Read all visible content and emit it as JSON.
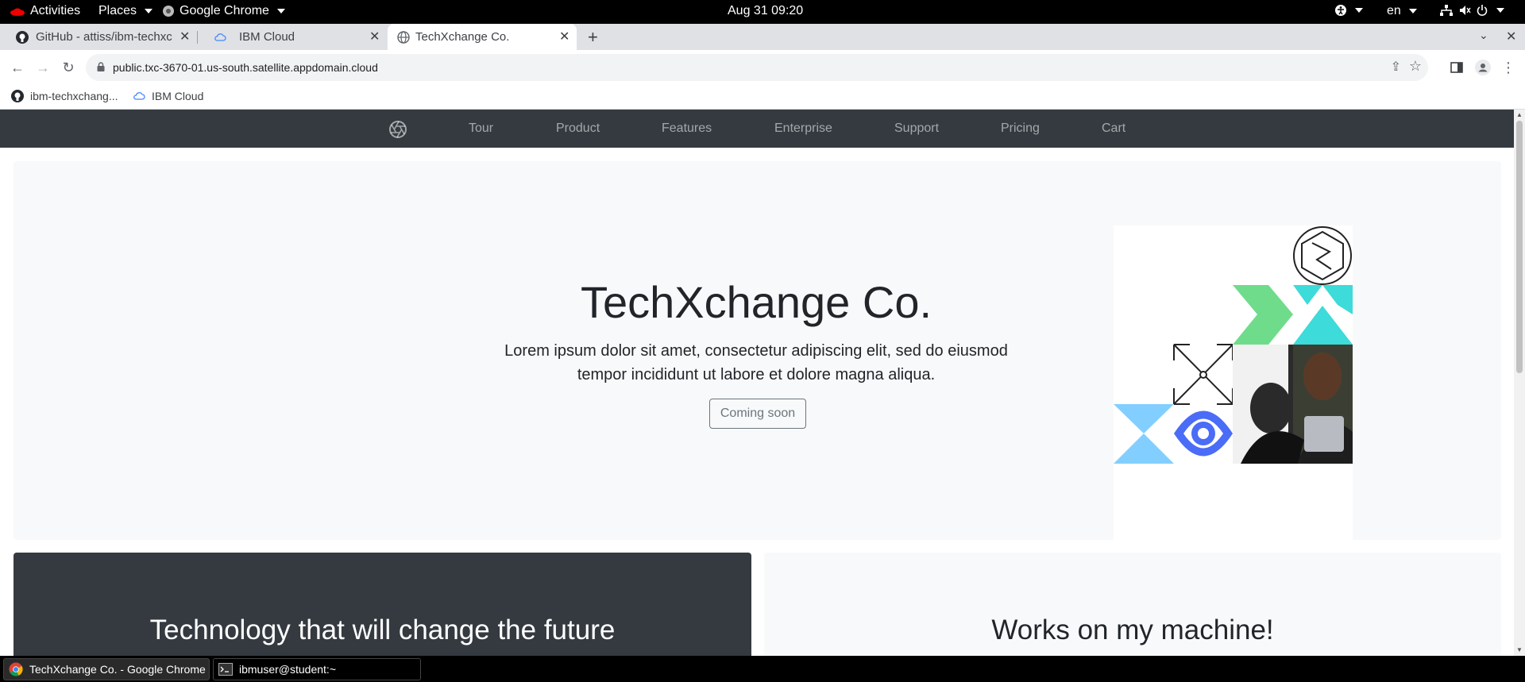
{
  "topbar": {
    "activities": "Activities",
    "places": "Places",
    "browser_app": "Google Chrome",
    "datetime": "Aug 31  09:20",
    "language": "en"
  },
  "tabs": [
    {
      "title": "GitHub - attiss/ibm-techxchange",
      "icon": "github-icon",
      "active": false
    },
    {
      "title": "IBM Cloud",
      "icon": "cloud-icon",
      "active": false
    },
    {
      "title": "TechXchange Co.",
      "icon": "globe-icon",
      "active": true
    }
  ],
  "toolbar": {
    "url": "public.txc-3670-01.us-south.satellite.appdomain.cloud"
  },
  "bookmarks": [
    {
      "label": "ibm-techxchang...",
      "icon": "github-icon"
    },
    {
      "label": "IBM Cloud",
      "icon": "cloud-icon"
    }
  ],
  "site": {
    "nav": [
      "Tour",
      "Product",
      "Features",
      "Enterprise",
      "Support",
      "Pricing",
      "Cart"
    ],
    "hero": {
      "title": "TechXchange Co.",
      "lead": "Lorem ipsum dolor sit amet, consectetur adipiscing elit, sed do eiusmod tempor incididunt ut labore et dolore magna aliqua.",
      "button": "Coming soon"
    },
    "panels": {
      "dark_title": "Technology that will change the future",
      "light_title": "Works on my machine!"
    }
  },
  "taskbar": [
    {
      "label": "TechXchange Co. - Google Chrome",
      "icon": "chrome-icon",
      "active": true
    },
    {
      "label": "ibmuser@student:~",
      "icon": "terminal-icon",
      "active": false
    }
  ],
  "colors": {
    "navbar": "#343a40",
    "hero_bg": "#f8f9fa",
    "accent_green": "#6fdc8c",
    "accent_teal": "#3ddbd9",
    "accent_lightblue": "#82cfff",
    "accent_blue": "#4a6cf7"
  }
}
